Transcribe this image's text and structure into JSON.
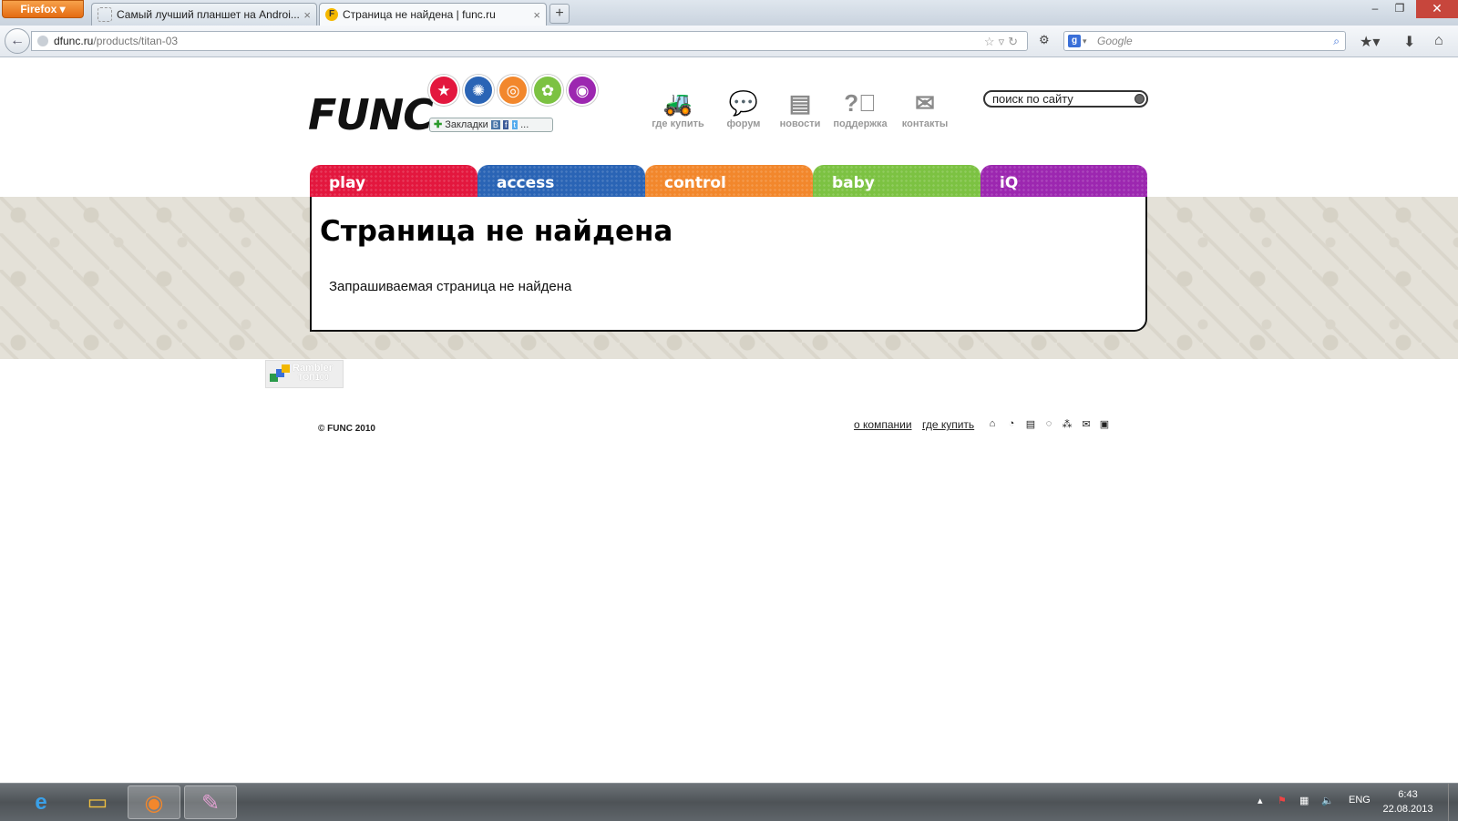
{
  "browser": {
    "menu_button": "Firefox",
    "tabs": [
      {
        "title": "Самый лучший планшет на Androi...",
        "active": false
      },
      {
        "title": "Страница не найдена | func.ru",
        "active": true
      }
    ],
    "new_tab": "+",
    "url_host": "dfunc.ru",
    "url_path": "/products/titan-03",
    "search_placeholder": "Google",
    "search_engine_icon": "g-icon"
  },
  "site": {
    "logo_text": "FUNC",
    "bookmarks_label": "Закладки",
    "bookmark_services": [
      "В",
      "f",
      "t",
      "..."
    ],
    "top_links": [
      {
        "label": "где купить",
        "icon": "truck-icon"
      },
      {
        "label": "форум",
        "icon": "speech-bubble-icon"
      },
      {
        "label": "новости",
        "icon": "notepad-icon"
      },
      {
        "label": "поддержка",
        "icon": "question-icon"
      },
      {
        "label": "контакты",
        "icon": "envelope-icon"
      }
    ],
    "search_placeholder": "поиск по сайту",
    "nav_tabs": [
      {
        "label": "play",
        "color": "#e3173e"
      },
      {
        "label": "access",
        "color": "#2a64b5"
      },
      {
        "label": "control",
        "color": "#f2872c"
      },
      {
        "label": "baby",
        "color": "#7cc242"
      },
      {
        "label": "iQ",
        "color": "#9c27b0"
      }
    ]
  },
  "content": {
    "title": "Страница не найдена",
    "message": "Запрашиваемая страница не найдена"
  },
  "footer": {
    "rambler_line1": "Rambler",
    "rambler_line2": "ТОП100",
    "copyright": "© FUNC 2010",
    "links": [
      "о компании",
      "где купить"
    ]
  },
  "taskbar": {
    "language": "ENG",
    "time": "6:43",
    "date": "22.08.2013"
  }
}
